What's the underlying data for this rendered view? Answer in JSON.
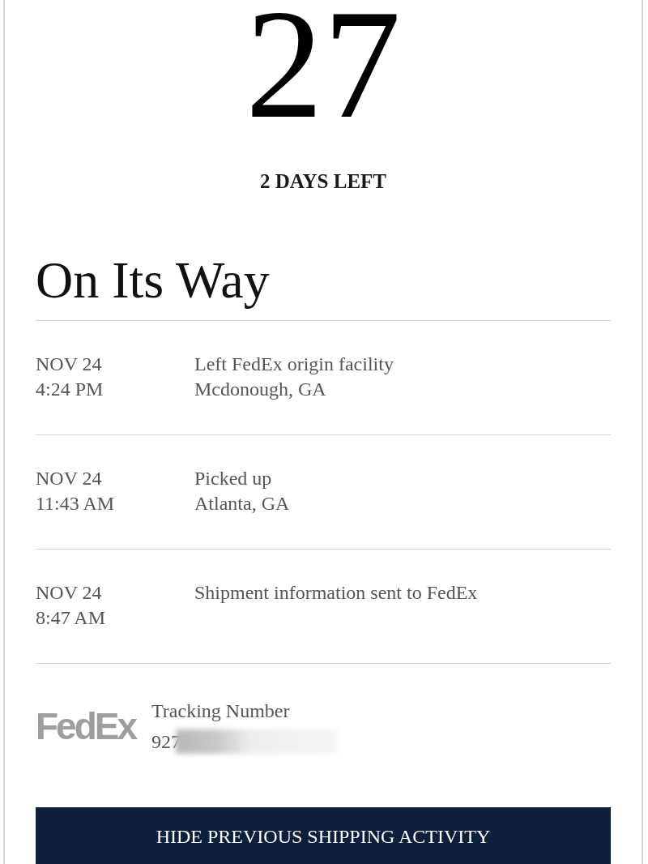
{
  "countdown": {
    "day": "27",
    "remaining": "2 DAYS LEFT"
  },
  "status": {
    "title": "On Its Way"
  },
  "activity": [
    {
      "date": "NOV 24",
      "time": "4:24 PM",
      "description": "Left FedEx origin facility",
      "location": "Mcdonough, GA"
    },
    {
      "date": "NOV 24",
      "time": "11:43 AM",
      "description": "Picked up",
      "location": "Atlanta, GA"
    },
    {
      "date": "NOV 24",
      "time": "8:47 AM",
      "description": "Shipment information sent to FedEx"
    }
  ],
  "tracking": {
    "carrier_logo": "FedEx",
    "label": "Tracking Number",
    "number": "927",
    "redacted": true
  },
  "toggle_button": {
    "label": "HIDE PREVIOUS SHIPPING ACTIVITY"
  }
}
